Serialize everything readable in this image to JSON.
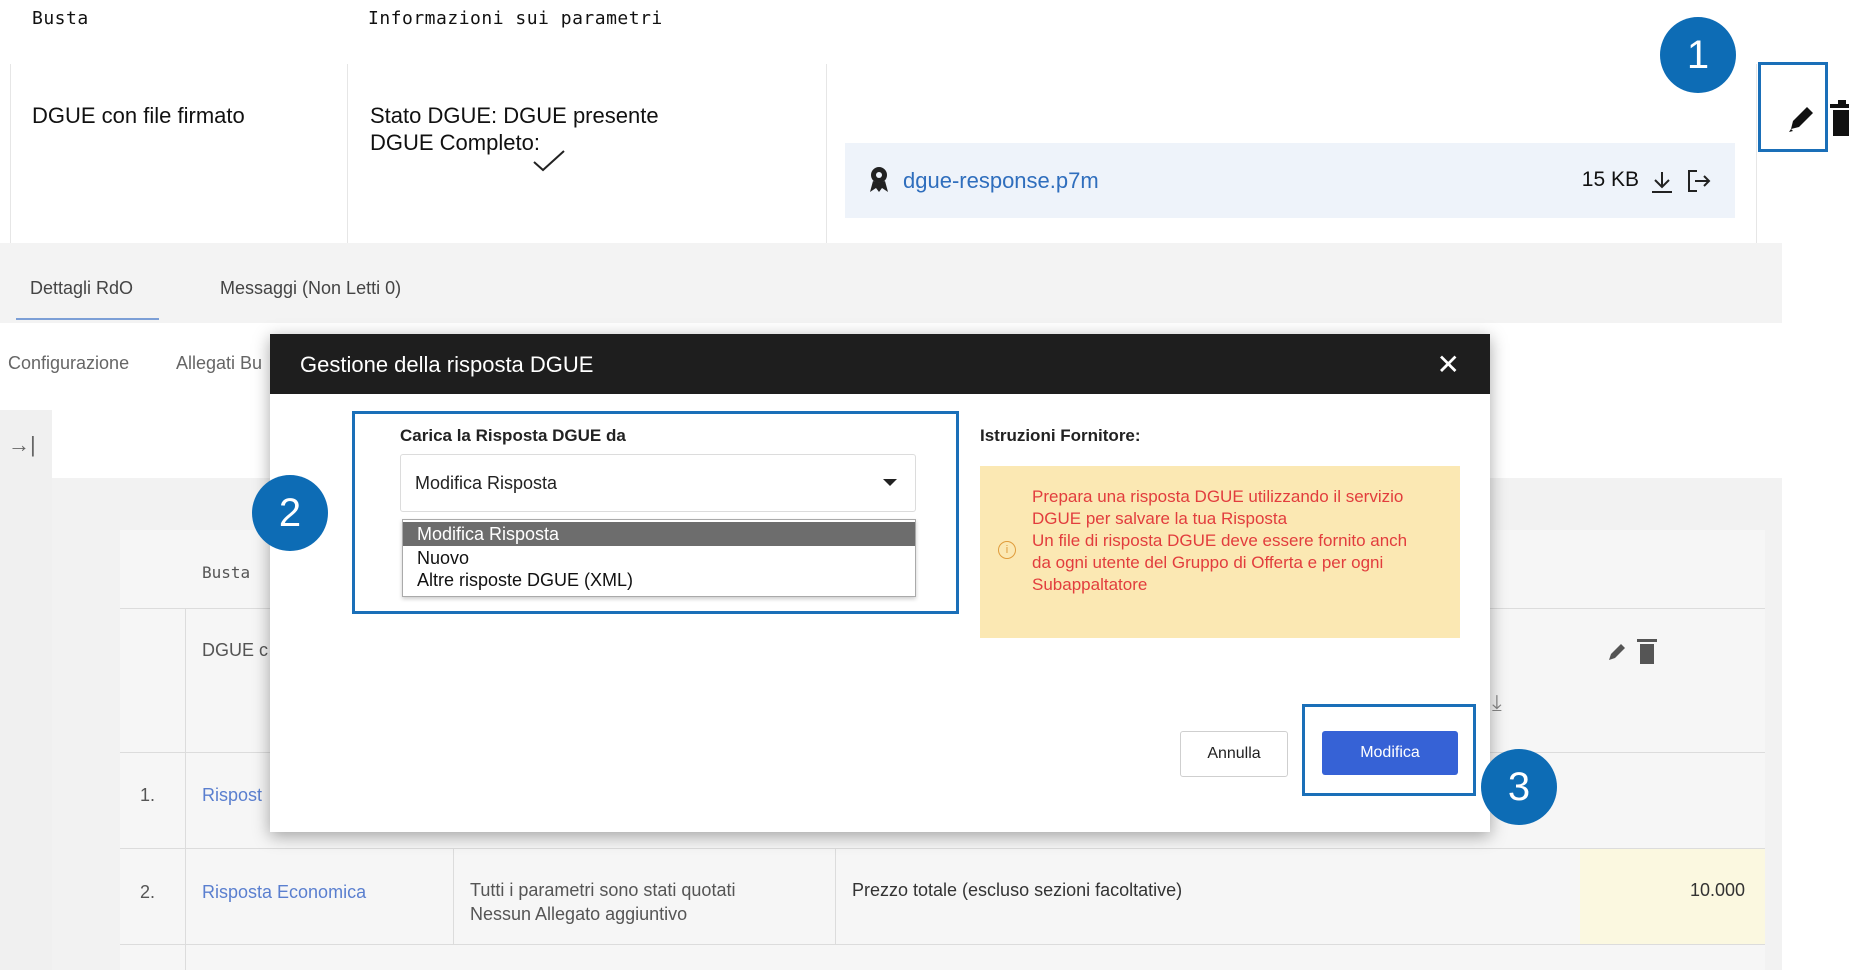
{
  "top_table": {
    "col_busta": "Busta",
    "col_info": "Informazioni sui parametri",
    "row_name": "DGUE con file firmato",
    "stato": "Stato DGUE: DGUE presente",
    "completo": "DGUE Completo:",
    "file_name": "dgue-response.p7m",
    "file_size": "15 KB"
  },
  "tabs": {
    "dettagli": "Dettagli RdO",
    "messaggi": "Messaggi (Non Letti 0)"
  },
  "subnav": {
    "configurazione": "Configurazione",
    "allegati": "Allegati Bu"
  },
  "bg_table": {
    "col_busta": "Busta",
    "row0_busta": "DGUE c",
    "row1_num": "1.",
    "row1_name": "Rispost",
    "row2_num": "2.",
    "row2_name": "Risposta Economica",
    "row2_info1": "Tutti i parametri sono stati quotati",
    "row2_info2": "Nessun Allegato aggiuntivo",
    "row2_param": "Prezzo totale (escluso sezioni facoltative)",
    "row2_value": "10.000"
  },
  "modal": {
    "title": "Gestione della risposta DGUE",
    "close": "✕",
    "load_label": "Carica la Risposta DGUE da",
    "selected_value": "Modifica Risposta",
    "options": [
      "Modifica Risposta",
      "Nuovo",
      "Altre risposte DGUE (XML)"
    ],
    "istruzioni_label": "Istruzioni Fornitore:",
    "notice_lines": [
      "Prepara una risposta DGUE utilizzando il servizio",
      "DGUE per salvare la tua Risposta",
      "Un file di risposta DGUE deve essere fornito anch",
      "da ogni utente del Gruppo di Offerta e per ogni",
      "Subappaltatore"
    ],
    "cancel_label": "Annulla",
    "ok_label": "Modifica"
  },
  "annotations": {
    "badge1": "1",
    "badge2": "2",
    "badge3": "3"
  },
  "colors": {
    "accent_blue": "#0d6cb5",
    "primary_button": "#3662d6",
    "notice_bg": "#fbe8b3",
    "notice_text": "#e23d3d"
  }
}
